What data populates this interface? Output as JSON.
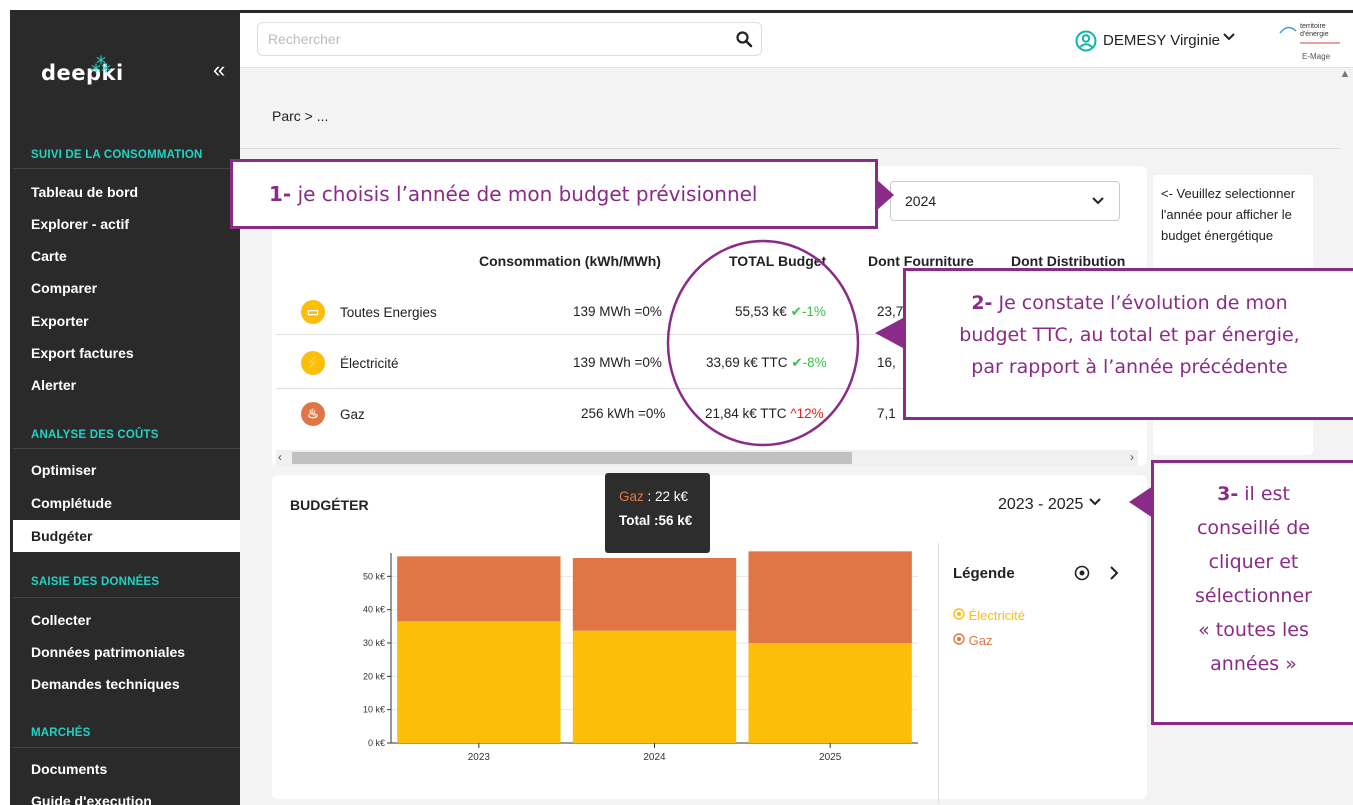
{
  "sidebar": {
    "logo": "deepki",
    "sections": [
      {
        "title": "SUIVI DE LA CONSOMMATION",
        "items": [
          "Tableau de bord",
          "Explorer - actif",
          "Carte",
          "Comparer",
          "Exporter",
          "Export factures",
          "Alerter"
        ]
      },
      {
        "title": "ANALYSE DES COÛTS",
        "items": [
          "Optimiser",
          "Complétude",
          "Budgéter"
        ]
      },
      {
        "title": "SAISIE DES DONNÉES",
        "items": [
          "Collecter",
          "Données patrimoniales",
          "Demandes techniques"
        ]
      },
      {
        "title": "MARCHÉS",
        "items": [
          "Documents",
          "Guide d'execution"
        ]
      }
    ],
    "active_item": "Budgéter"
  },
  "topbar": {
    "search_placeholder": "Rechercher",
    "user_name": "DEMESY Virginie",
    "brand_line1": "territoire",
    "brand_line2": "d'énergie",
    "brand_line3": "E-Mage"
  },
  "breadcrumb": "Parc  >  ...",
  "budget_table": {
    "year_selected": "2024",
    "headers": [
      "Consommation (kWh/MWh)",
      "TOTAL Budget",
      "Dont Fourniture",
      "Dont Distribution"
    ],
    "rows": [
      {
        "label": "Toutes Energies",
        "consumption": "139 MWh =0%",
        "total": "55,53 k€",
        "trend": "-1%",
        "trend_dir": "down",
        "fourniture": "23,7"
      },
      {
        "label": "Électricité",
        "consumption": "139 MWh =0%",
        "total": "33,69 k€ TTC",
        "trend": "-8%",
        "trend_dir": "down",
        "fourniture": "16,"
      },
      {
        "label": "Gaz",
        "consumption": "256 kWh =0%",
        "total": "21,84 k€ TTC",
        "trend": "12%",
        "trend_dir": "up",
        "fourniture": "7,1"
      }
    ]
  },
  "hint": {
    "text": "<- Veuillez selectionner l'année pour afficher le budget énergétique"
  },
  "callouts": {
    "c1_num": "1-",
    "c1_text": " je choisis l’année de mon budget prévisionnel",
    "c2_num": "2-",
    "c2_line1": " Je constate l’évolution de mon",
    "c2_line2": "budget TTC, au total et par énergie,",
    "c2_line3": "par rapport à l’année précédente",
    "c3_num": "3-",
    "c3_l1": " il est",
    "c3_l2": "conseillé de",
    "c3_l3": "cliquer et",
    "c3_l4": "sélectionner",
    "c3_l5": "« toutes les",
    "c3_l6": "années »"
  },
  "budget_chart": {
    "title": "BUDGÉTER",
    "period": "2023 - 2025",
    "legend_title": "Légende",
    "tooltip_series": "Gaz",
    "tooltip_value": " : 22 k€",
    "tooltip_total": "Total :56 k€",
    "colors": {
      "electricite": "#fbbe09",
      "gaz": "#e07646"
    }
  },
  "chart_data": {
    "type": "bar",
    "stacked": true,
    "categories": [
      "2023",
      "2024",
      "2025"
    ],
    "series": [
      {
        "name": "Électricité",
        "values": [
          36.5,
          33.7,
          30
        ]
      },
      {
        "name": "Gaz",
        "values": [
          19.5,
          21.8,
          27.5
        ]
      }
    ],
    "ylim": [
      0,
      57
    ],
    "yticks": [
      "0 k€",
      "10 k€",
      "20 k€",
      "30 k€",
      "40 k€",
      "50 k€"
    ],
    "grid": true,
    "legend": "right"
  }
}
